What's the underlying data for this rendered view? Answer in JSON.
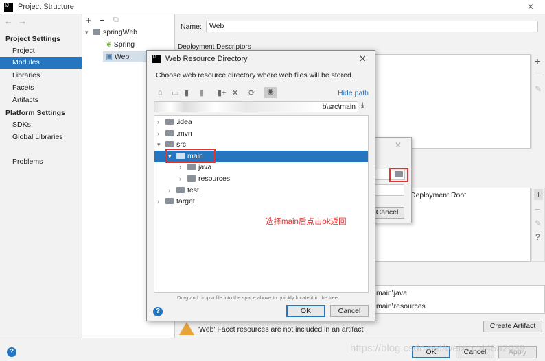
{
  "window": {
    "title": "Project Structure",
    "close": "✕"
  },
  "nav": {
    "back": "←",
    "forward": "→"
  },
  "sidebar": {
    "project_settings": "Project Settings",
    "items1": [
      "Project",
      "Modules",
      "Libraries",
      "Facets",
      "Artifacts"
    ],
    "platform_settings": "Platform Settings",
    "items2": [
      "SDKs",
      "Global Libraries"
    ],
    "problems": "Problems",
    "selected": "Modules"
  },
  "module_tree": {
    "toolbar": [
      "+",
      "−",
      "⧉"
    ],
    "root": "springWeb",
    "children": [
      "Spring",
      "Web"
    ],
    "selected": "Web"
  },
  "main": {
    "name_label": "Name:",
    "name_value": "Web",
    "deployment_descriptors": "Deployment Descriptors",
    "deployment_root": "Deployment Root",
    "source_roots": [
      "main\\java",
      "main\\resources"
    ],
    "warning": "'Web' Facet resources are not included in an artifact",
    "create_artifact": "Create Artifact",
    "side_tools": [
      "+",
      "−",
      "✎",
      "?"
    ]
  },
  "small_dialog": {
    "cancel": "Cancel"
  },
  "dialog": {
    "title": "Web Resource Directory",
    "description": "Choose web resource directory where web files will be stored.",
    "hide_path": "Hide path",
    "path_value": "b\\src\\main",
    "tree": [
      {
        "label": ".idea",
        "level": 0,
        "expanded": false
      },
      {
        "label": ".mvn",
        "level": 0,
        "expanded": false
      },
      {
        "label": "src",
        "level": 0,
        "expanded": true
      },
      {
        "label": "main",
        "level": 1,
        "expanded": true,
        "selected": true
      },
      {
        "label": "java",
        "level": 2,
        "expanded": false
      },
      {
        "label": "resources",
        "level": 2,
        "expanded": false
      },
      {
        "label": "test",
        "level": 1,
        "expanded": false
      },
      {
        "label": "target",
        "level": 0,
        "expanded": false
      }
    ],
    "hint": "Drag and drop a file into the space above to quickly locate it in the tree",
    "ok": "OK",
    "cancel": "Cancel"
  },
  "annotation": {
    "text": "选择main后点击ok返回",
    "color": "#e8312f"
  },
  "footer": {
    "ok": "OK",
    "cancel": "Cancel",
    "apply": "Apply"
  },
  "watermark": "https://blog.csdn.net/weixin_44552039",
  "colors": {
    "selection": "#2675bf",
    "highlight_box": "#e8312f",
    "link": "#2675bf"
  }
}
